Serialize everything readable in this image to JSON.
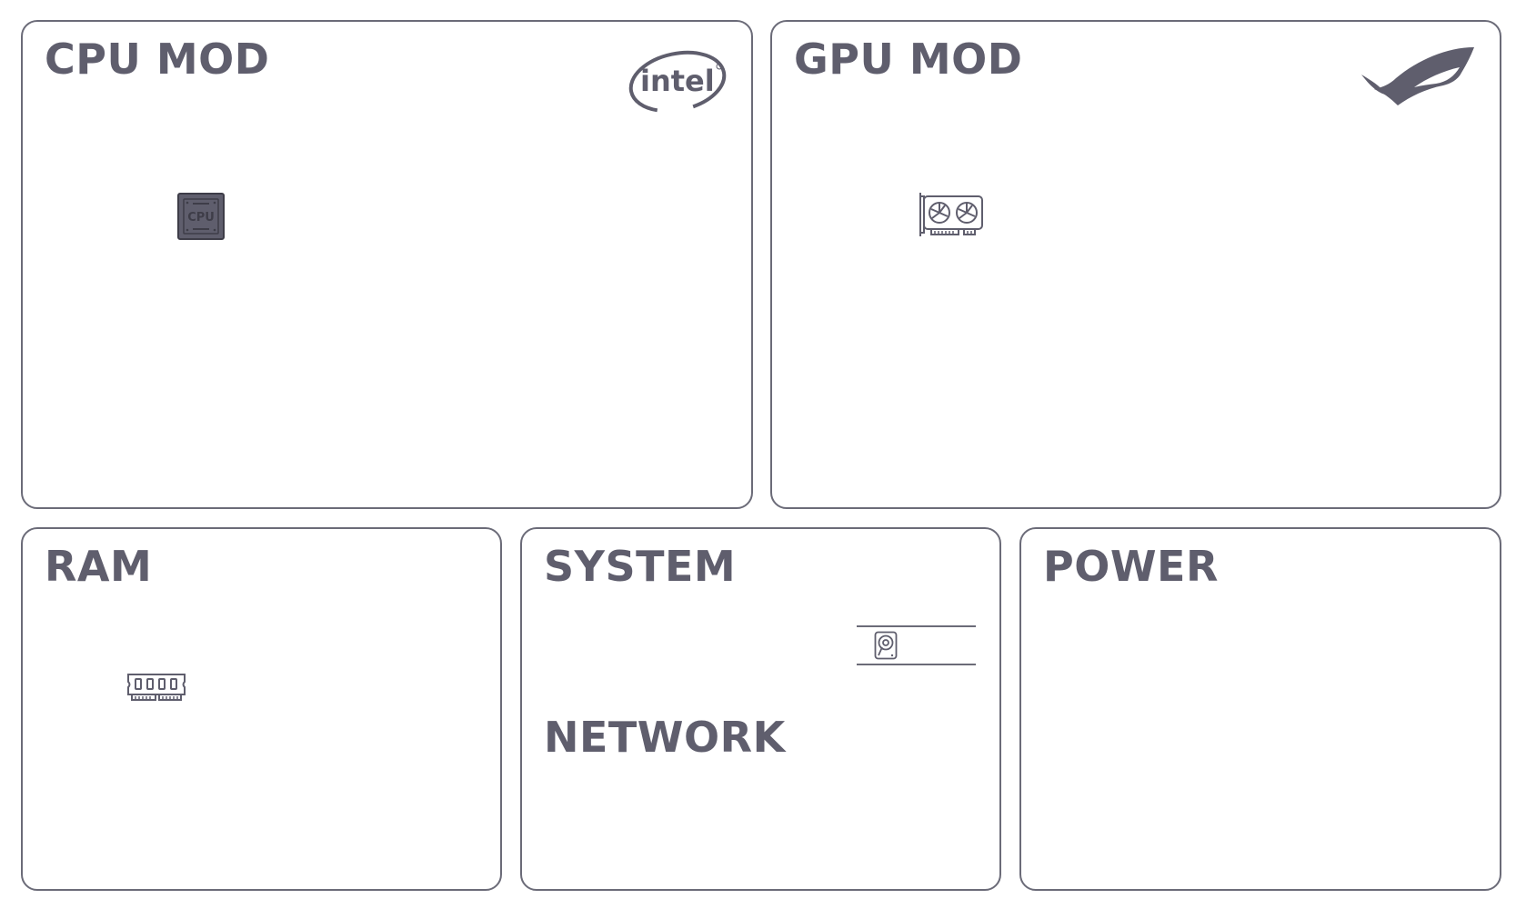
{
  "panels": {
    "cpu": {
      "title": "CPU MOD",
      "brand_icon": "intel-logo",
      "device_icon": "cpu-chip-icon",
      "chip_label": "CPU"
    },
    "gpu": {
      "title": "GPU MOD",
      "brand_icon": "rog-logo",
      "device_icon": "graphics-card-icon"
    },
    "ram": {
      "title": "RAM",
      "device_icon": "ram-stick-icon"
    },
    "system": {
      "title": "SYSTEM",
      "device_icon": "hard-disk-icon",
      "network_title": "NETWORK"
    },
    "power": {
      "title": "POWER"
    }
  },
  "logos": {
    "intel_text": "intel"
  },
  "colors": {
    "border": "#6b6b78",
    "text": "#5f5e6d",
    "icon": "#5f5e6d",
    "background": "#ffffff"
  }
}
